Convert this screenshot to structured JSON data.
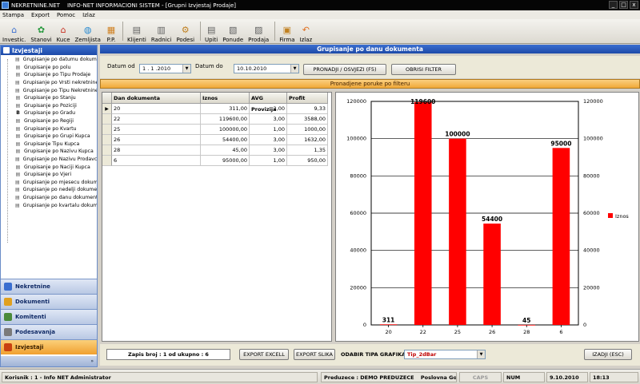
{
  "window": {
    "app_name": "NEKRETNINE.NET",
    "title": "INFO-NET INFORMACIONI SISTEM - [Grupni Izvjestaj Prodaje]",
    "min": "_",
    "max": "□",
    "close": "x"
  },
  "menu": [
    "Stampa",
    "Export",
    "Pomoc",
    "Izlaz"
  ],
  "toolbar": [
    {
      "label": "Investic.",
      "icon": "house-icon",
      "color": "#3a6ed0"
    },
    {
      "label": "Stanovi",
      "icon": "flowers-icon",
      "color": "#2a9a40"
    },
    {
      "label": "Kuce",
      "icon": "house-red-icon",
      "color": "#c83020"
    },
    {
      "label": "Zemljista",
      "icon": "globe-icon",
      "color": "#2a8ad0"
    },
    {
      "label": "P.P.",
      "icon": "chart-icon",
      "color": "#d08020"
    },
    {
      "label": "Klijenti",
      "icon": "clients-icon",
      "color": "#606060"
    },
    {
      "label": "Radnici",
      "icon": "workers-icon",
      "color": "#606060"
    },
    {
      "label": "Podesi",
      "icon": "settings-icon",
      "color": "#c08020"
    },
    {
      "label": "Upiti",
      "icon": "query-icon",
      "color": "#606060"
    },
    {
      "label": "Ponude",
      "icon": "offer-icon",
      "color": "#606060"
    },
    {
      "label": "Prodaja",
      "icon": "sale-icon",
      "color": "#606060"
    },
    {
      "label": "Firma",
      "icon": "firm-icon",
      "color": "#c08020"
    },
    {
      "label": "Izlaz",
      "icon": "exit-icon",
      "color": "#e07020"
    }
  ],
  "sidebar": {
    "title": "Izvjestaji",
    "tree": [
      "Grupisanje po datumu dokumenta",
      "Grupisanje po polu",
      "Grupisanje po Tipu Prodaje",
      "Grupisanje po Vrsti nekretnine",
      "Grupisanje po Tipu Nekretnine",
      "Grupisanje po Stanju",
      "Grupisanje po Poziciji",
      "Grupisanje po Gradu",
      "Grupisanje po Regiji",
      "Grupisanje po Kvartu",
      "Grupisanje po Grupi Kupca",
      "Grupisanje Tipu Kupca",
      "Grupisanje po Nazivu Kupca",
      "Grupisanje po Nazivu Prodavca",
      "Grupisanje po Naciji Kupca",
      "Grupisanje po Vjeri",
      "Grupisanje po mjesecu dokumenta",
      "Grupisanje po nedelji dokumenta",
      "Grupisanje po danu dokumenta",
      "Grupisanje po kvartalu dokumenta"
    ],
    "tree_bold": "B",
    "nav": [
      {
        "label": "Nekretnine",
        "color": "#3a6ed0"
      },
      {
        "label": "Dokumenti",
        "color": "#e0a020"
      },
      {
        "label": "Komitenti",
        "color": "#4a8a3a"
      },
      {
        "label": "Podesavanja",
        "color": "#7a7a7a"
      },
      {
        "label": "Izvjestaji",
        "color": "#c84010"
      }
    ],
    "footer": "»"
  },
  "main": {
    "title": "Grupisanje po danu dokumenta",
    "filter": {
      "datum_od_label": "Datum od",
      "datum_od_value": "1 . 1 .2010",
      "datum_do_label": "Datum do",
      "datum_do_value": "10.10.2010",
      "find_button": "PRONADJI / OSVJEZI (F5)",
      "clear_button": "OBRISI FILTER"
    },
    "panel_title": "Pronadjene poruke po filteru",
    "grid": {
      "columns": [
        "Dan dokumenta",
        "Iznos",
        "AVG Provizija",
        "Profit"
      ],
      "rows": [
        [
          "20",
          "311,00",
          "2,00",
          "9,33"
        ],
        [
          "22",
          "119600,00",
          "3,00",
          "3588,00"
        ],
        [
          "25",
          "100000,00",
          "1,00",
          "1000,00"
        ],
        [
          "26",
          "54400,00",
          "3,00",
          "1632,00"
        ],
        [
          "28",
          "45,00",
          "3,00",
          "1,35"
        ],
        [
          "6",
          "95000,00",
          "1,00",
          "950,00"
        ]
      ],
      "selected_marker": "▶"
    },
    "bottom": {
      "records": "Zapis broj : 1 od ukupno : 6",
      "export_excel": "EXPORT EXCELL",
      "export_image": "EXPORT SLIKA",
      "chart_type_label": "ODABIR TIPA GRAFIKA",
      "chart_type_value": "Tip_2dBar",
      "exit_button": "IZADJI (ESC)"
    }
  },
  "chart_data": {
    "type": "bar",
    "categories": [
      "20",
      "22",
      "25",
      "26",
      "28",
      "6"
    ],
    "values": [
      311,
      119600,
      100000,
      54400,
      45,
      95000
    ],
    "value_labels": [
      "311",
      "119600",
      "100000",
      "54400",
      "45",
      "95000"
    ],
    "y_ticks": [
      "0",
      "20000",
      "40000",
      "60000",
      "80000",
      "100000",
      "120000"
    ],
    "ylim": [
      0,
      120000
    ],
    "series": [
      {
        "name": "Iznos",
        "color": "#ff0000"
      }
    ],
    "grid": true,
    "legend": "right"
  },
  "status": {
    "user": "Korisnik : 1 - Info NET  Administrator",
    "company": "Preduzece : DEMO PREDUZECE",
    "year": "Poslovna Godina :2010",
    "caps": "CAPS",
    "num": "NUM",
    "date": "9.10.2010",
    "time": "18:13"
  }
}
